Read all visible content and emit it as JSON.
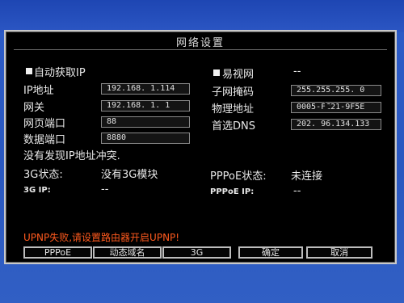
{
  "dialog": {
    "title": "网络设置",
    "dhcp_label": "自动获取IP",
    "ip_label": "IP地址",
    "ip_value": "192.168.  1.114",
    "gateway_label": "网关",
    "gateway_value": "192.168.  1.  1",
    "web_port_label": "网页端口",
    "web_port_value": "88",
    "data_port_label": "数据端口",
    "data_port_value": "8880",
    "status_text": "没有发现IP地址冲突.",
    "ez_label": "易视网",
    "ez_value": "--",
    "subnet_label": "子网掩码",
    "subnet_value": "255.255.255.  0",
    "mac_label": "物理地址",
    "mac_value": "0005-FE21-9F5E",
    "dns_label": "首选DNS",
    "dns_value": "202. 96.134.133",
    "g3_status_label": "3G状态:",
    "g3_status_value": "没有3G模块",
    "pppoe_status_label": "PPPoE状态:",
    "pppoe_status_value": "未连接",
    "g3_ip_label": "3G IP:",
    "g3_ip_value": "--",
    "pppoe_ip_label": "PPPoE IP:",
    "pppoe_ip_value": "--",
    "upnp_warning": "UPNP失败,请设置路由器开启UPNP!"
  },
  "buttons": {
    "pppoe": "PPPoE",
    "ddns": "动态域名",
    "g3": "3G",
    "ok": "确定",
    "cancel": "取消"
  },
  "colors": {
    "background": "#2d5cc8",
    "dialog": "#000000",
    "warning": "#ff5a1e"
  }
}
